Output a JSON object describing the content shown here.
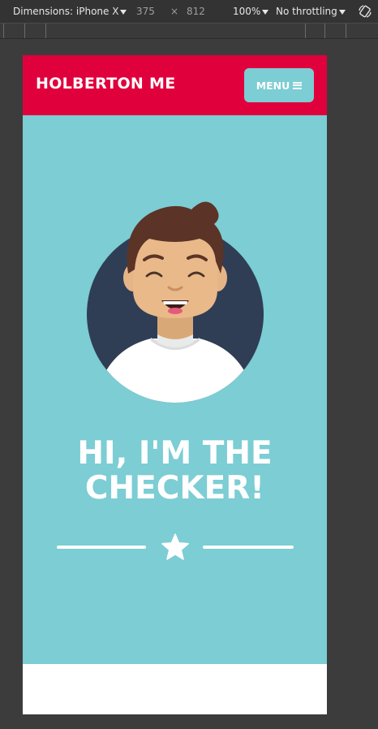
{
  "devtools": {
    "device_label": "Dimensions: iPhone X",
    "width": "375",
    "times": "×",
    "height": "812",
    "zoom": "100%",
    "throttling": "No throttling",
    "rotate_icon": "rotate-device-icon"
  },
  "site": {
    "brand": "HOLBERTON ME",
    "menu_label": "MENU",
    "menu_icon": "hamburger-icon",
    "hero_title_line1": "HI, I'M THE",
    "hero_title_line2": "CHECKER!",
    "divider_icon": "star-icon",
    "colors": {
      "header": "#e0003c",
      "hero": "#7ccdd4",
      "avatar_bg": "#2f3e55",
      "text": "#ffffff"
    }
  }
}
